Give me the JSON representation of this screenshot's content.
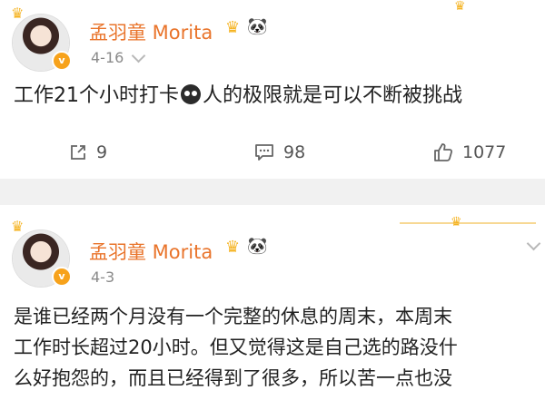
{
  "posts": [
    {
      "username": "孟羽童 Morita",
      "badge_icon": "crown-panda-badge-icon",
      "date": "4-16",
      "text_before_emoji": "工作21个小时打卡",
      "emoji": "black-face-emoji",
      "text_after_emoji": "人的极限就是可以不断被挑战",
      "actions": {
        "share_count": "9",
        "comment_count": "98",
        "like_count": "1077"
      }
    },
    {
      "username": "孟羽童 Morita",
      "badge_icon": "crown-panda-badge-icon",
      "date": "4-3",
      "lines": [
        "是谁已经两个月没有一个完整的休息的周末，本周末",
        "工作时长超过20小时。但又觉得这是自己选的路没什",
        "么好抱怨的，而且已经得到了很多，所以苦一点也没"
      ]
    }
  ],
  "colors": {
    "username": "#e9742b",
    "crown": "#f5b321",
    "date": "#8a8a8a"
  }
}
